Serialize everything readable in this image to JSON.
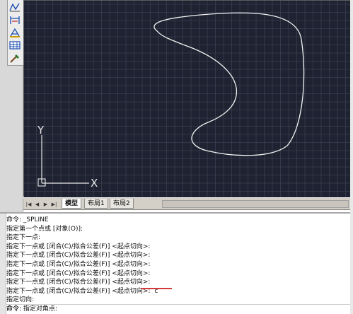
{
  "toolbar": {
    "icons": [
      "polyline-icon",
      "dimension-icon",
      "text-icon",
      "table-icon",
      "match-properties-icon"
    ]
  },
  "canvas": {
    "background": "#1f2230",
    "grid_color": "#3a3e52",
    "ucs_y_label": "Y",
    "ucs_x_label": "X"
  },
  "tabs": {
    "items": [
      "模型",
      "布局1",
      "布局2"
    ],
    "active": "模型"
  },
  "command": {
    "lines": [
      "命令: _SPLINE",
      "指定第一个点或 [对象(O)]:",
      "指定下一点:",
      "指定下一点或 [闭合(C)/拟合公差(F)] <起点切向>:",
      "指定下一点或 [闭合(C)/拟合公差(F)] <起点切向>:",
      "指定下一点或 [闭合(C)/拟合公差(F)] <起点切向>:",
      "指定下一点或 [闭合(C)/拟合公差(F)] <起点切向>:",
      "指定下一点或 [闭合(C)/拟合公差(F)] <起点切向>:",
      "指定下一点或 [闭合(C)/拟合公差(F)] <起点切向>:",
      "指定切向:",
      "命令: 指定对角点:"
    ],
    "typed_input": "c",
    "prompt": "命令:"
  }
}
